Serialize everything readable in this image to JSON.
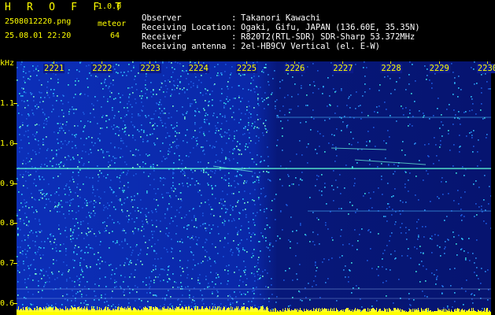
{
  "header": {
    "app_title": "H R O F F T",
    "app_version": "1.0.0",
    "filename": "2508012220.png",
    "mode": "meteor",
    "datetime": "25.08.01 22:20",
    "count": "64",
    "info": [
      {
        "key": "Observer",
        "value": "Takanori Kawachi"
      },
      {
        "key": "Receiving Location",
        "value": "Ogaki, Gifu, JAPAN (136.60E, 35.35N)"
      },
      {
        "key": "Receiver",
        "value": "R820T2(RTL-SDR) SDR-Sharp 53.372MHz"
      },
      {
        "key": "Receiving antenna",
        "value": "2el-HB9CV Vertical (el. E-W)"
      }
    ]
  },
  "axes": {
    "y_unit": "kHz",
    "y_ticks": [
      "1.1",
      "1.0",
      "0.9",
      "0.8",
      "0.7",
      "0.6"
    ],
    "y_values": [
      1.1,
      1.0,
      0.9,
      0.8,
      0.7,
      0.6
    ],
    "y_range": [
      0.57,
      1.205
    ],
    "x_ticks": [
      "2221",
      "2222",
      "2223",
      "2224",
      "2225",
      "2226",
      "2227",
      "2228",
      "2229",
      "2230"
    ]
  },
  "colors": {
    "label": "#ffff00",
    "text": "#ffffff",
    "background": "#000000",
    "noise_low": "#0a1e9c",
    "noise_high": "#20c0ff",
    "signal": "#40ffd0"
  }
}
